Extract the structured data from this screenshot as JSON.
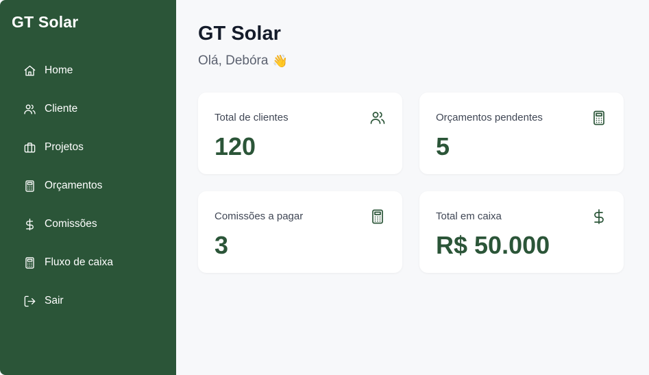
{
  "sidebar": {
    "brand": "GT Solar",
    "items": [
      {
        "label": "Home",
        "icon": "home-icon"
      },
      {
        "label": "Cliente",
        "icon": "users-icon"
      },
      {
        "label": "Projetos",
        "icon": "briefcase-icon"
      },
      {
        "label": "Orçamentos",
        "icon": "calculator-icon"
      },
      {
        "label": "Comissões",
        "icon": "dollar-icon"
      },
      {
        "label": "Fluxo de caixa",
        "icon": "calculator-icon"
      },
      {
        "label": "Sair",
        "icon": "logout-icon"
      }
    ]
  },
  "main": {
    "title": "GT Solar",
    "greeting": "Olá, Debóra",
    "greeting_emoji": "👋",
    "cards": [
      {
        "title": "Total de clientes",
        "value": "120",
        "icon": "users-icon"
      },
      {
        "title": "Orçamentos pendentes",
        "value": "5",
        "icon": "calculator-icon"
      },
      {
        "title": "Comissões a pagar",
        "value": "3",
        "icon": "calculator-icon"
      },
      {
        "title": "Total em caixa",
        "value": "R$ 50.000",
        "icon": "dollar-icon"
      }
    ]
  },
  "colors": {
    "sidebar_bg": "#2b5538",
    "accent": "#2b5538",
    "page_bg": "#f7f8fa",
    "card_bg": "#ffffff"
  }
}
